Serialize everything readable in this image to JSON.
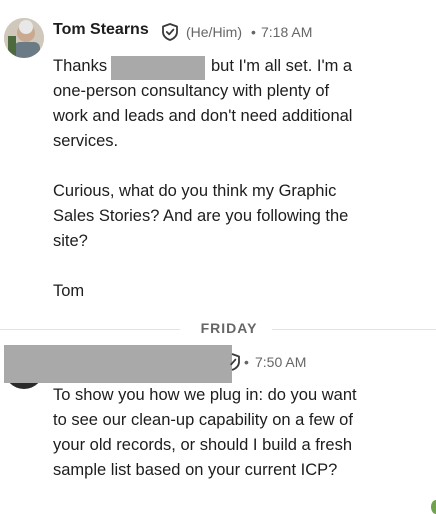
{
  "message1": {
    "sender": "Tom Stearns",
    "pronouns": "(He/Him)",
    "separator": "•",
    "time": "7:18 AM",
    "line1_start": "Thanks",
    "line1_end": "but I'm all set. I'm a",
    "line2": "one-person consultancy with plenty of",
    "line3": "work and leads and don't need additional",
    "line4": "services.",
    "line5": "Curious, what do you think my Graphic",
    "line6": "Sales Stories? And are you following the",
    "line7": "site?",
    "line8": "Tom"
  },
  "day_divider": "FRIDAY",
  "message2": {
    "separator": "•",
    "time": "7:50 AM",
    "line1": "To show you how we plug in: do you want",
    "line2": "to see our clean-up capability on a few of",
    "line3": "your old records, or should I build a fresh",
    "line4": "sample list based on your current ICP?"
  },
  "icons": {
    "verified": "shield-check-icon"
  }
}
